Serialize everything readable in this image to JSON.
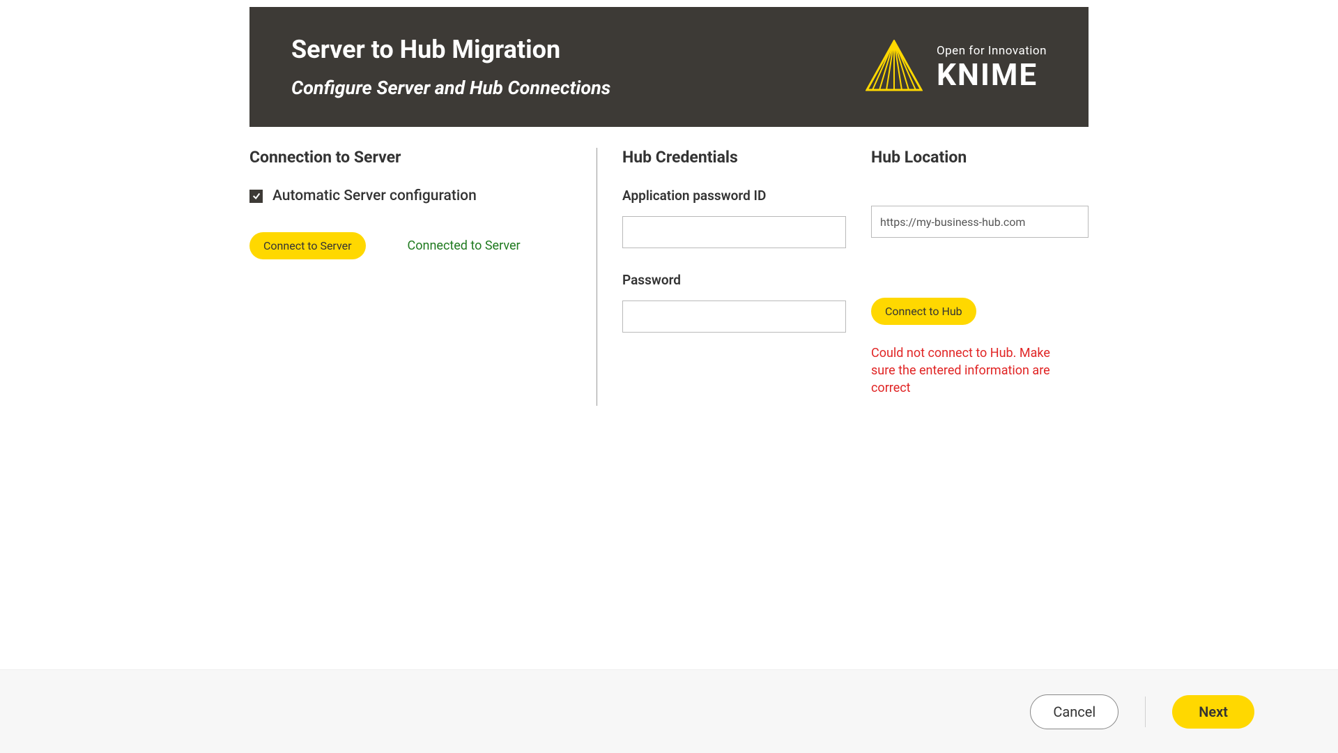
{
  "header": {
    "title": "Server to Hub Migration",
    "subtitle": "Configure Server and Hub Connections",
    "logo": {
      "tagline": "Open for Innovation",
      "name": "KNIME"
    }
  },
  "server": {
    "heading": "Connection to Server",
    "auto_label": "Automatic Server configuration",
    "auto_checked": true,
    "connect_label": "Connect to Server",
    "status": "Connected to Server"
  },
  "hub_credentials": {
    "heading": "Hub Credentials",
    "app_pw_id_label": "Application password ID",
    "app_pw_id_value": "",
    "password_label": "Password",
    "password_value": ""
  },
  "hub_location": {
    "heading": "Hub Location",
    "url_value": "https://my-business-hub.com",
    "connect_label": "Connect to Hub",
    "error": "Could not connect to Hub. Make sure the entered information are correct"
  },
  "footer": {
    "cancel_label": "Cancel",
    "next_label": "Next"
  },
  "colors": {
    "accent": "#ffd800",
    "header_bg": "#3d3a36",
    "error": "#e02424",
    "ok": "#1f7a1f"
  }
}
